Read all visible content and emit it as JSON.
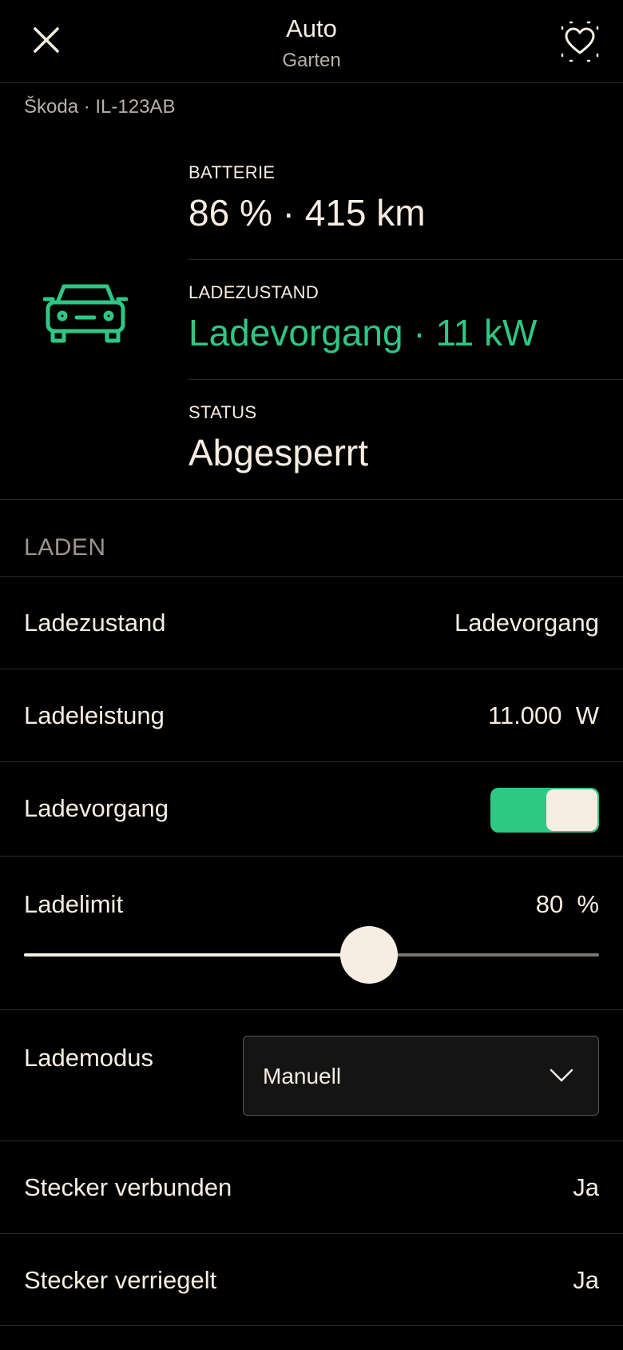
{
  "header": {
    "title": "Auto",
    "subtitle": "Garten",
    "close_icon": "close-icon",
    "favorite_icon": "heart-icon"
  },
  "vehicle": {
    "name_plate": "Škoda · IL-123AB",
    "icon": "car-icon",
    "stats": [
      {
        "label": "BATTERIE",
        "value": "86 % · 415 km"
      },
      {
        "label": "LADEZUSTAND",
        "value": "Ladevorgang · 11 kW"
      },
      {
        "label": "STATUS",
        "value": "Abgesperrt"
      }
    ]
  },
  "section": {
    "title": "LADEN",
    "rows": {
      "ladezustand": {
        "label": "Ladezustand",
        "value": "Ladevorgang"
      },
      "ladeleistung": {
        "label": "Ladeleistung",
        "value": "11.000  W"
      },
      "ladevorgang": {
        "label": "Ladevorgang",
        "on": true
      },
      "ladelimit": {
        "label": "Ladelimit",
        "value": "80  %",
        "slider_fraction": 0.6
      },
      "lademodus": {
        "label": "Lademodus",
        "selected": "Manuell"
      },
      "stecker_verbunden": {
        "label": "Stecker verbunden",
        "value": "Ja"
      },
      "stecker_verriegelt": {
        "label": "Stecker verriegelt",
        "value": "Ja"
      }
    }
  },
  "colors": {
    "accent_green": "#2fc784",
    "text": "#f7ede2",
    "muted": "#b8b0a8",
    "background": "#000000"
  }
}
